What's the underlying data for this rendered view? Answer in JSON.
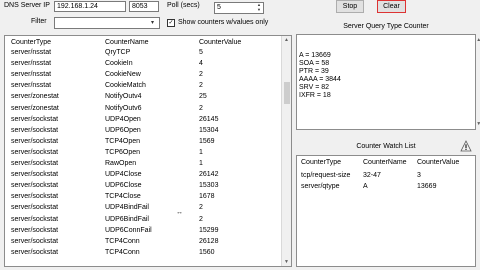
{
  "top": {
    "dns_label": "DNS Server IP",
    "dns_value": "192.168.1.24",
    "port_value": "8053",
    "poll_label": "Poll (secs)",
    "poll_value": "5",
    "stop_label": "Stop",
    "clear_label": "Clear",
    "filter_label": "Filter",
    "filter_value": "",
    "show_counters_label": "Show counters w/values only",
    "show_counters_checked": true
  },
  "counters": {
    "columns": [
      "CounterType",
      "CounterName",
      "CounterValue"
    ],
    "rows": [
      [
        "server/nsstat",
        "QryTCP",
        "5"
      ],
      [
        "server/nsstat",
        "CookieIn",
        "4"
      ],
      [
        "server/nsstat",
        "CookieNew",
        "2"
      ],
      [
        "server/nsstat",
        "CookieMatch",
        "2"
      ],
      [
        "server/zonestat",
        "NotifyOutv4",
        "25"
      ],
      [
        "server/zonestat",
        "NotifyOutv6",
        "2"
      ],
      [
        "server/sockstat",
        "UDP4Open",
        "26145"
      ],
      [
        "server/sockstat",
        "UDP6Open",
        "15304"
      ],
      [
        "server/sockstat",
        "TCP4Open",
        "1569"
      ],
      [
        "server/sockstat",
        "TCP6Open",
        "1"
      ],
      [
        "server/sockstat",
        "RawOpen",
        "1"
      ],
      [
        "server/sockstat",
        "UDP4Close",
        "26142"
      ],
      [
        "server/sockstat",
        "UDP6Close",
        "15303"
      ],
      [
        "server/sockstat",
        "TCP4Close",
        "1678"
      ],
      [
        "server/sockstat",
        "UDP4BindFail",
        "2"
      ],
      [
        "server/sockstat",
        "UDP6BindFail",
        "2"
      ],
      [
        "server/sockstat",
        "UDP6ConnFail",
        "15299"
      ],
      [
        "server/sockstat",
        "TCP4Conn",
        "26128"
      ],
      [
        "server/sockstat",
        "TCP4Conn",
        "1560"
      ]
    ]
  },
  "query_type": {
    "title": "Server Query Type Counter",
    "lines": [
      "A = 13669",
      "SOA = 58",
      "PTR = 39",
      "AAAA = 3844",
      "SRV = 82",
      "IXFR = 18"
    ]
  },
  "watch": {
    "title": "Counter Watch List",
    "columns": [
      "CounterType",
      "CounterName",
      "CounterValue"
    ],
    "rows": [
      [
        "tcp/request-size",
        "32-47",
        "3"
      ],
      [
        "server/qtype",
        "A",
        "13669"
      ]
    ]
  },
  "icons": {
    "warning": "warning-icon",
    "checkbox": "checkbox-checked-icon",
    "dropdown": "chevron-down-icon",
    "spinner": "spinner-arrows-icon",
    "cursor": "mouse-cursor-icon"
  }
}
